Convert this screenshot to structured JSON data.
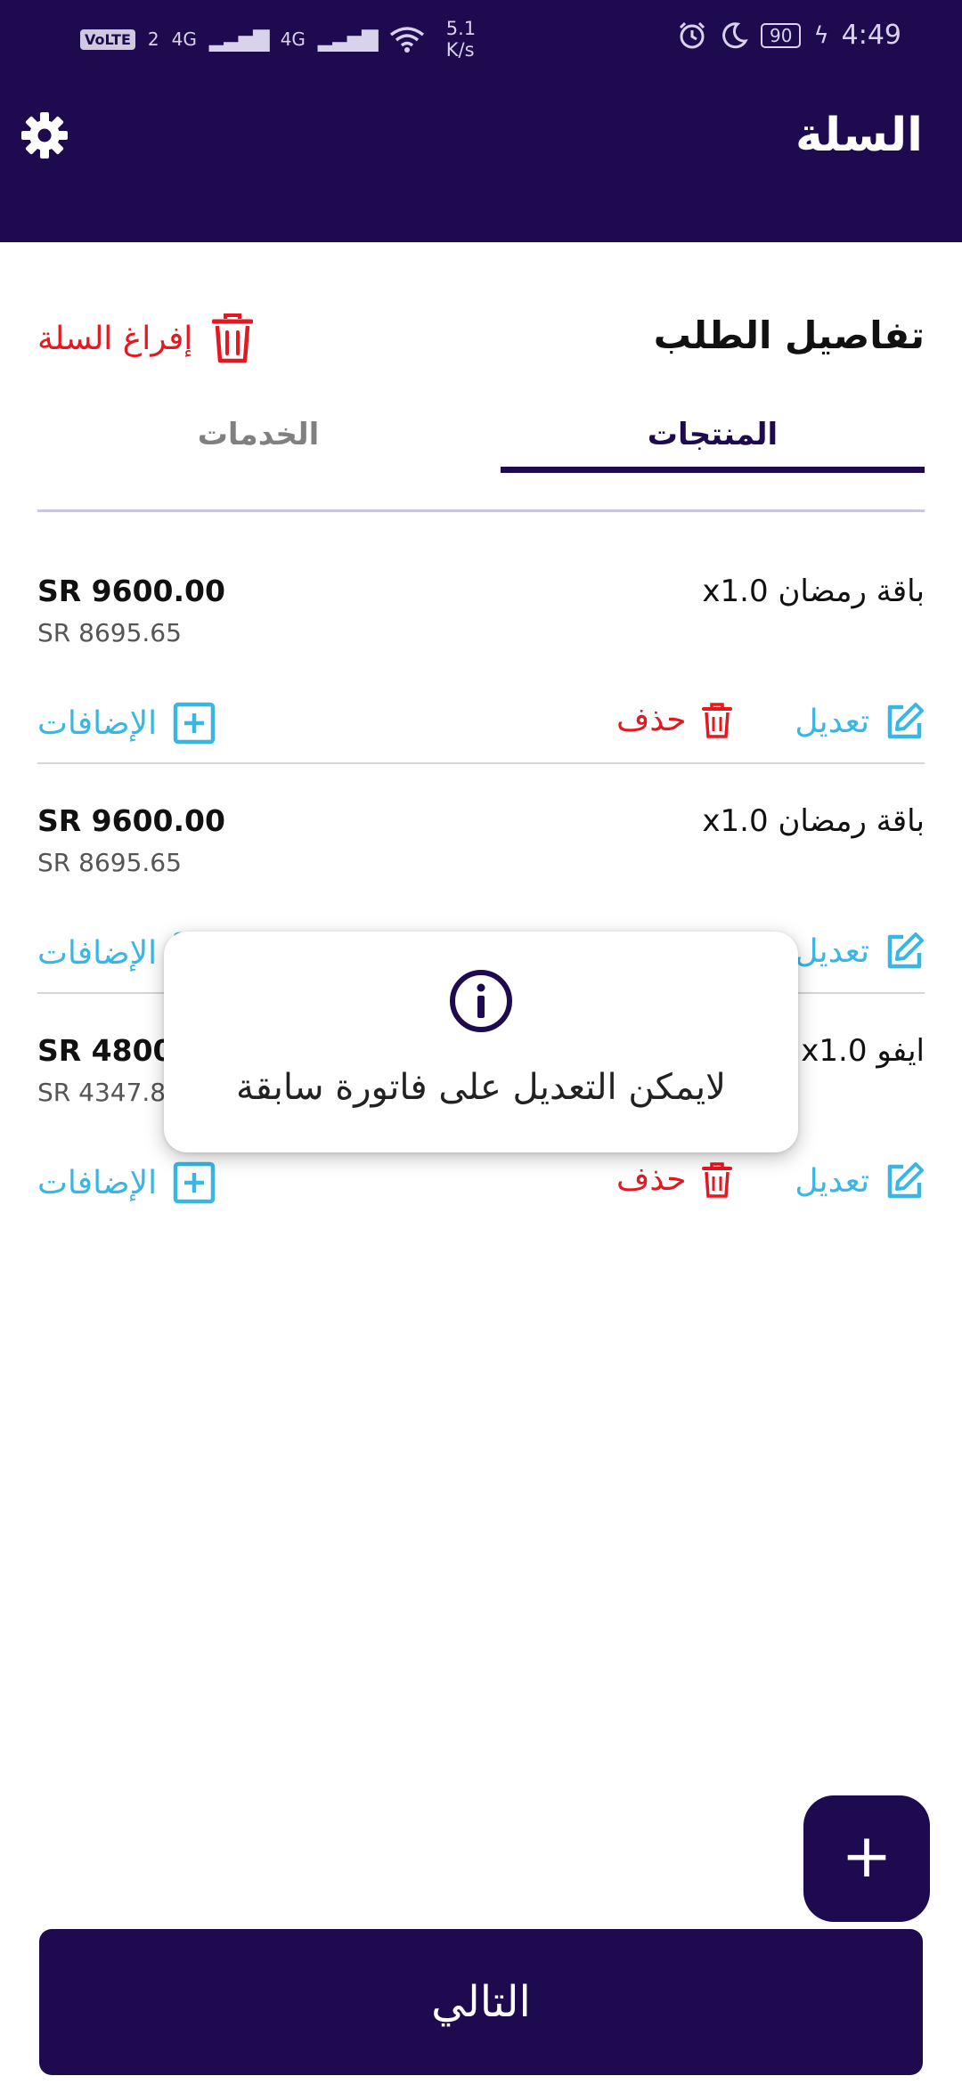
{
  "status_bar": {
    "volte": "VoLTE",
    "sim": "2",
    "net1": "4G",
    "net2": "4G",
    "speed_value": "5.1",
    "speed_unit": "K/s",
    "battery": "90",
    "time": "4:49"
  },
  "header": {
    "title": "السلة"
  },
  "order": {
    "title": "تفاصيل الطلب",
    "empty_cart_label": "إفراغ السلة"
  },
  "tabs": [
    {
      "label": "المنتجات",
      "selected": true
    },
    {
      "label": "الخدمات",
      "selected": false
    }
  ],
  "items": [
    {
      "name": "باقة رمضان",
      "qty": "x1.0",
      "price": "SR 9600.00",
      "price_before": "SR 8695.65"
    },
    {
      "name": "باقة رمضان",
      "qty": "x1.0",
      "price": "SR 9600.00",
      "price_before": "SR 8695.65"
    },
    {
      "name": "ايفو",
      "qty": "x1.0",
      "price": "SR 4800.",
      "price_before": "SR 4347.8"
    }
  ],
  "actions": {
    "edit": "تعديل",
    "delete": "حذف",
    "addons": "الإضافات"
  },
  "toast": {
    "message": "لايمكن التعديل على فاتورة سابقة",
    "icon": "info-icon"
  },
  "fab": {
    "label": "+"
  },
  "next_button": {
    "label": "التالي"
  },
  "colors": {
    "primary": "#1d0a4f",
    "danger": "#e5171f",
    "link": "#3ab6e4"
  }
}
